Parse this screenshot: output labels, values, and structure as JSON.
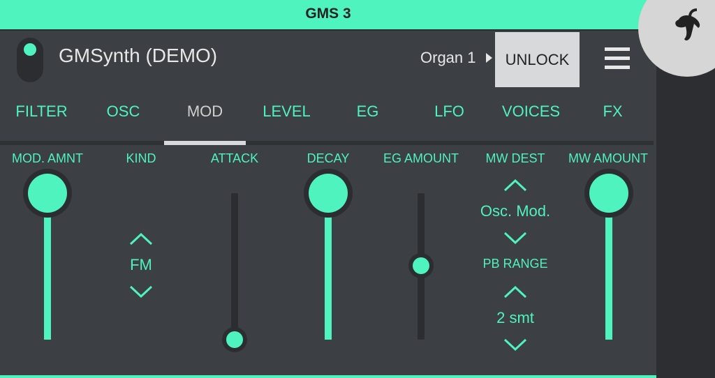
{
  "window": {
    "title": "GMS 3"
  },
  "header": {
    "app_title": "GMSynth (DEMO)",
    "preset": "Organ 1",
    "unlock_label": "UNLOCK"
  },
  "tabs": [
    {
      "label": "FILTER"
    },
    {
      "label": "OSC"
    },
    {
      "label": "MOD",
      "active": true
    },
    {
      "label": "LEVEL"
    },
    {
      "label": "EG"
    },
    {
      "label": "LFO"
    },
    {
      "label": "VOICES"
    },
    {
      "label": "FX"
    }
  ],
  "controls": {
    "mod_amnt": {
      "label": "MOD. AMNT",
      "level": 1.0
    },
    "kind": {
      "label": "KIND",
      "value": "FM"
    },
    "attack": {
      "label": "ATTACK",
      "level": 0.0
    },
    "decay": {
      "label": "DECAY",
      "level": 1.0
    },
    "eg_amount": {
      "label": "EG AMOUNT",
      "level": 0.5
    },
    "mw_dest": {
      "label": "MW DEST",
      "value": "Osc. Mod."
    },
    "pb_range": {
      "label": "PB RANGE",
      "value": "2 smt"
    },
    "mw_amount": {
      "label": "MW AMOUNT",
      "level": 1.0
    }
  },
  "colors": {
    "accent": "#4ff3be",
    "background": "#3c3f43",
    "track": "#2b2d30"
  },
  "icons": {
    "logo": "fruit-logo-icon",
    "menu": "hamburger-menu-icon",
    "preset_arrow": "triangle-right-icon"
  }
}
